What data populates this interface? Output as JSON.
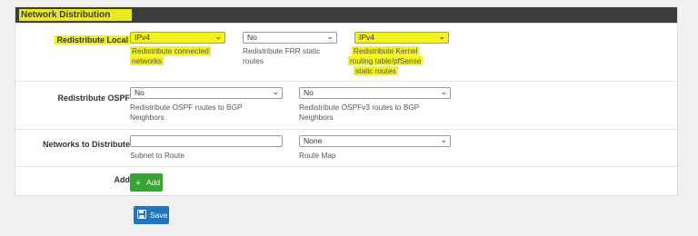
{
  "section": {
    "title": "Network Distribution"
  },
  "redistribute_local": {
    "label": "Redistribute Local",
    "connected": {
      "value": "IPv4",
      "help": [
        "Redistribute connected",
        "networks"
      ]
    },
    "frr_static": {
      "value": "No",
      "help": [
        "Redistribute FRR static",
        "routes"
      ]
    },
    "kernel": {
      "value": "IPv4",
      "help": [
        "Redistribute Kernel",
        "routing table/pfSense",
        "static routes"
      ]
    }
  },
  "redistribute_ospf": {
    "label": "Redistribute OSPF",
    "ospf": {
      "value": "No",
      "help": [
        "Redistribute OSPF routes to BGP",
        "Neighbors"
      ]
    },
    "ospfv3": {
      "value": "No",
      "help": [
        "Redistribute OSPFv3 routes to BGP",
        "Neighbors"
      ]
    }
  },
  "networks": {
    "label": "Networks to Distribute",
    "subnet": {
      "value": "",
      "help": "Subnet to Route"
    },
    "route_map": {
      "value": "None",
      "help": "Route Map"
    }
  },
  "add_row": {
    "label": "Add",
    "button": "Add"
  },
  "save_button": "Save",
  "colors": {
    "highlight": "#f2f21e",
    "add": "#3aa336",
    "save": "#1e75c4",
    "heading": "#3c3c3c"
  },
  "icons": {
    "add": "plus-icon",
    "save": "save-icon",
    "dropdown": "chevron-down-icon"
  }
}
